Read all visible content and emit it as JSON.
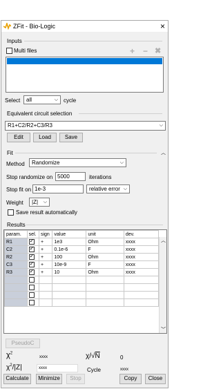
{
  "window": {
    "title": "ZFit - Bio-Logic",
    "close_icon": "×"
  },
  "inputs": {
    "section": "Inputs",
    "multi_files_label": "Multi files",
    "selected_file": "",
    "select_label": "Select",
    "select_value": "all",
    "cycle_label": "cycle"
  },
  "circuit": {
    "section": "Equivalent circuit selection",
    "value": "R1+C2/R2+C3/R3",
    "edit": "Edit",
    "load": "Load",
    "save": "Save"
  },
  "fit": {
    "section": "Fit",
    "method_label": "Method",
    "method_value": "Randomize",
    "stop_randomize_label": "Stop randomize on",
    "stop_randomize_value": "5000",
    "iterations_label": "iterations",
    "stop_fit_label": "Stop fit on",
    "stop_fit_value": "1e-3",
    "error_value": "relative error",
    "weight_label": "Weight",
    "weight_value": "|Z|",
    "save_auto_label": "Save result automatically"
  },
  "results": {
    "section": "Results",
    "columns": [
      "param.",
      "sel.",
      "sign",
      "value",
      "unit",
      "dev."
    ],
    "rows": [
      {
        "param": "R1",
        "sign": "+",
        "value": "1e3",
        "unit": "Ohm",
        "dev": "xxxx"
      },
      {
        "param": "C2",
        "sign": "+",
        "value": "0.1e-6",
        "unit": "F",
        "dev": "xxxx"
      },
      {
        "param": "R2",
        "sign": "+",
        "value": "100",
        "unit": "Ohm",
        "dev": "xxxx"
      },
      {
        "param": "C3",
        "sign": "+",
        "value": "10e-9",
        "unit": "F",
        "dev": "xxxx"
      },
      {
        "param": "R3",
        "sign": "+",
        "value": "10",
        "unit": "Ohm",
        "dev": "xxxx"
      }
    ],
    "pseudoc": "PseudoC",
    "chi2_value": "xxxx",
    "chi2_sqrt_value": "0",
    "chi2_z_value": "xxxx",
    "cycle_label": "Cycle",
    "cycle_value": "xxxx",
    "iterations_label": "Iterations",
    "iterations_value": "xxxx"
  },
  "footer": {
    "calculate": "Calculate",
    "minimize": "Minimize",
    "stop": "Stop",
    "copy": "Copy",
    "close": "Close"
  },
  "colors": {
    "selection": "#0078d7",
    "param_bg": "#c9cfda"
  }
}
